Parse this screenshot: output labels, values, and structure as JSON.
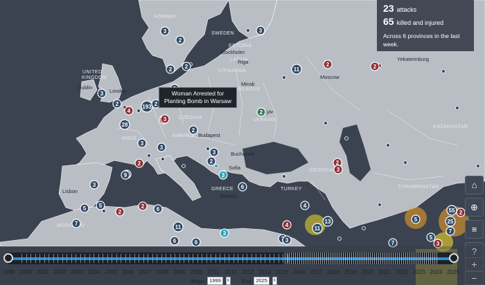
{
  "summary": {
    "attacks_count": "23",
    "attacks_label": "attacks",
    "casualties_count": "65",
    "casualties_label": "killed and injured",
    "description": "Across 6 provinces in the last week."
  },
  "tooltip": {
    "text": "Woman Arrested for\nPlanting Bomb in Warsaw"
  },
  "map": {
    "labels": {
      "norway": "NORWAY",
      "sweden": "SWEDEN",
      "estonia": "ESTONIA",
      "latvia": "LATVIA",
      "lithuania": "LITHUANIA",
      "belarus": "BELARUS",
      "united_kingdom": "UNITED",
      "united_kingdom_2": "KINGDOM",
      "ukraine": "UKRAINE",
      "czechia": "CZECHIA",
      "austria": "AUSTRIA",
      "france": "ANCE",
      "greece": "GREECE",
      "kazakhstan": "KAZAKHSTAN",
      "turkmenistan": "TURKMENISTAN",
      "georgia": "GEORGIA",
      "turkey": "TURKEY",
      "morocco": "MOROCCO",
      "stockholm": "Stockholm",
      "riga": "Riga",
      "minsk": "Minsk",
      "dublin": "Dublin",
      "london": "London",
      "moscow": "Moscow",
      "kyiv": "Kyiv",
      "bucharest": "Bucharest",
      "sofia": "Sofia",
      "athens": "Athens",
      "lisbon": "Lisbon",
      "yekaterinburg": "Yekaterinburg",
      "budapest": "Budapest"
    },
    "markers": [
      {
        "v": "3",
        "c": "blue"
      },
      {
        "v": "2",
        "c": "blue"
      },
      {
        "v": "3",
        "c": "blue"
      },
      {
        "v": "2",
        "c": "red"
      },
      {
        "v": "11",
        "c": "blue"
      },
      {
        "v": "2",
        "c": "blue"
      },
      {
        "v": "2",
        "c": "blue"
      },
      {
        "v": "3",
        "c": "blue"
      },
      {
        "v": "4",
        "c": "red"
      },
      {
        "v": "193",
        "c": "blue"
      },
      {
        "v": "3",
        "c": "red"
      },
      {
        "v": "28",
        "c": "blue"
      },
      {
        "v": "3",
        "c": "blue"
      },
      {
        "v": "3",
        "c": "blue"
      },
      {
        "v": "2",
        "c": "green"
      },
      {
        "v": "3",
        "c": "blue"
      },
      {
        "v": "2",
        "c": "blue"
      },
      {
        "v": "3",
        "c": "red"
      },
      {
        "v": "2",
        "c": "red"
      },
      {
        "v": "9",
        "c": "blue"
      },
      {
        "v": "5",
        "c": "blue"
      },
      {
        "v": "2",
        "c": "red"
      },
      {
        "v": "3",
        "c": "blue"
      },
      {
        "v": "2",
        "c": "red"
      },
      {
        "v": "2",
        "c": "red"
      },
      {
        "v": "7",
        "c": "blue"
      },
      {
        "v": "4",
        "c": "blue"
      },
      {
        "v": "6",
        "c": "blue"
      },
      {
        "v": "6",
        "c": "blue"
      },
      {
        "v": "7",
        "c": "blue"
      },
      {
        "v": "11",
        "c": "blue"
      },
      {
        "v": "6",
        "c": "blue"
      },
      {
        "v": "3",
        "c": "teal"
      },
      {
        "v": "4",
        "c": "red"
      },
      {
        "v": "11",
        "c": "blue"
      },
      {
        "v": "3",
        "c": "blue"
      },
      {
        "v": "5",
        "c": "blue"
      },
      {
        "v": "5",
        "c": "blue"
      },
      {
        "v": "7",
        "c": "blue"
      },
      {
        "v": "3",
        "c": "red"
      },
      {
        "v": "25",
        "c": "blue"
      },
      {
        "v": "55",
        "c": "blue"
      },
      {
        "v": "3",
        "c": "red"
      },
      {
        "v": "7",
        "c": "blue"
      },
      {
        "v": "2",
        "c": "red"
      },
      {
        "v": "3",
        "c": "blue"
      },
      {
        "v": "2",
        "c": "blue"
      },
      {
        "v": "2",
        "c": "blue"
      },
      {
        "v": "9",
        "c": "blue"
      },
      {
        "v": "5",
        "c": "blue"
      },
      {
        "v": "2",
        "c": "red"
      },
      {
        "v": "13",
        "c": "blue"
      },
      {
        "v": "6",
        "c": "blue"
      },
      {
        "v": "3",
        "c": "teal"
      },
      {
        "v": "2",
        "c": "blue"
      }
    ]
  },
  "colors": {
    "blue": "#2f4a66",
    "red": "#8c2f36",
    "teal": "#2aa3b8",
    "green": "#3a7a54",
    "accent": "#2d8fd1"
  },
  "timeline": {
    "years": [
      "1999",
      "2000",
      "2001",
      "2002",
      "2003",
      "2004",
      "2005",
      "2006",
      "2007",
      "2008",
      "2009",
      "2010",
      "2011",
      "2012",
      "2013",
      "2014",
      "2015",
      "2016",
      "2017",
      "2018",
      "2019",
      "2020",
      "2021",
      "2022",
      "2023",
      "2024",
      "2025"
    ],
    "begin_label": "Begin",
    "begin_value": "1999",
    "end_label": "End",
    "end_value": "2025"
  },
  "controls": {
    "home_icon": "home-icon",
    "locate_icon": "crosshair-icon",
    "layers_icon": "menu-icon",
    "help_icon": "help-icon",
    "zoom_in": "+",
    "zoom_out": "−"
  }
}
